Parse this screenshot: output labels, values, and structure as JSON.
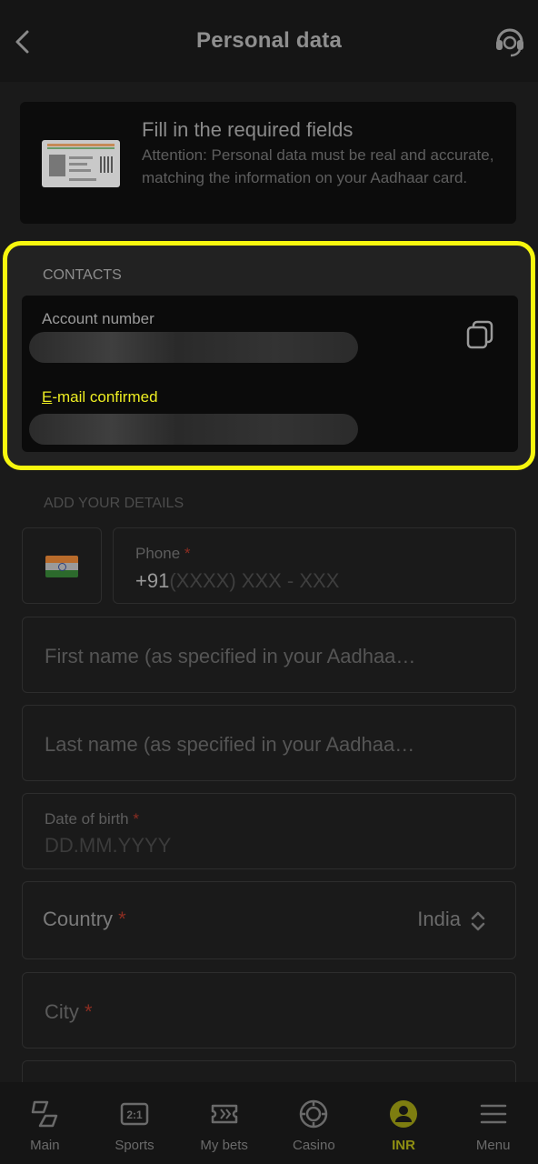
{
  "header": {
    "title": "Personal data",
    "back_icon": "chevron-left-icon",
    "support_icon": "headset-icon"
  },
  "info": {
    "title": "Fill in the required fields",
    "text": "Attention: Personal data must be real and accurate, matching the information on your Aadhaar card.",
    "image": "aadhaar-card-icon"
  },
  "contacts": {
    "section_label": "CONTACTS",
    "account_label": "Account number",
    "email_label_first": "E",
    "email_label_rest": "-mail confirmed",
    "copy_icon": "copy-icon"
  },
  "details": {
    "section_label": "ADD YOUR DETAILS",
    "phone_label": "Phone",
    "required_mark": "*",
    "phone_prefix": "+91",
    "phone_mask": "(XXXX) XXX - XXX",
    "first_name_placeholder": "First name (as specified in your Aadhaa…",
    "last_name_placeholder": "Last name (as specified in your Aadhaa…",
    "dob_label": "Date of birth",
    "dob_placeholder": "DD.MM.YYYY",
    "country_label": "Country",
    "country_value": "India",
    "city_label": "City"
  },
  "nav": [
    {
      "label": "Main",
      "icon": "main-icon"
    },
    {
      "label": "Sports",
      "icon": "sports-icon"
    },
    {
      "label": "My bets",
      "icon": "ticket-icon"
    },
    {
      "label": "Casino",
      "icon": "casino-chip-icon"
    },
    {
      "label": "INR",
      "icon": "user-icon",
      "active": true
    },
    {
      "label": "Menu",
      "icon": "menu-icon"
    }
  ],
  "colors": {
    "highlight": "#f7f70e",
    "accent": "#8f8f12",
    "required": "#8b2d22"
  }
}
